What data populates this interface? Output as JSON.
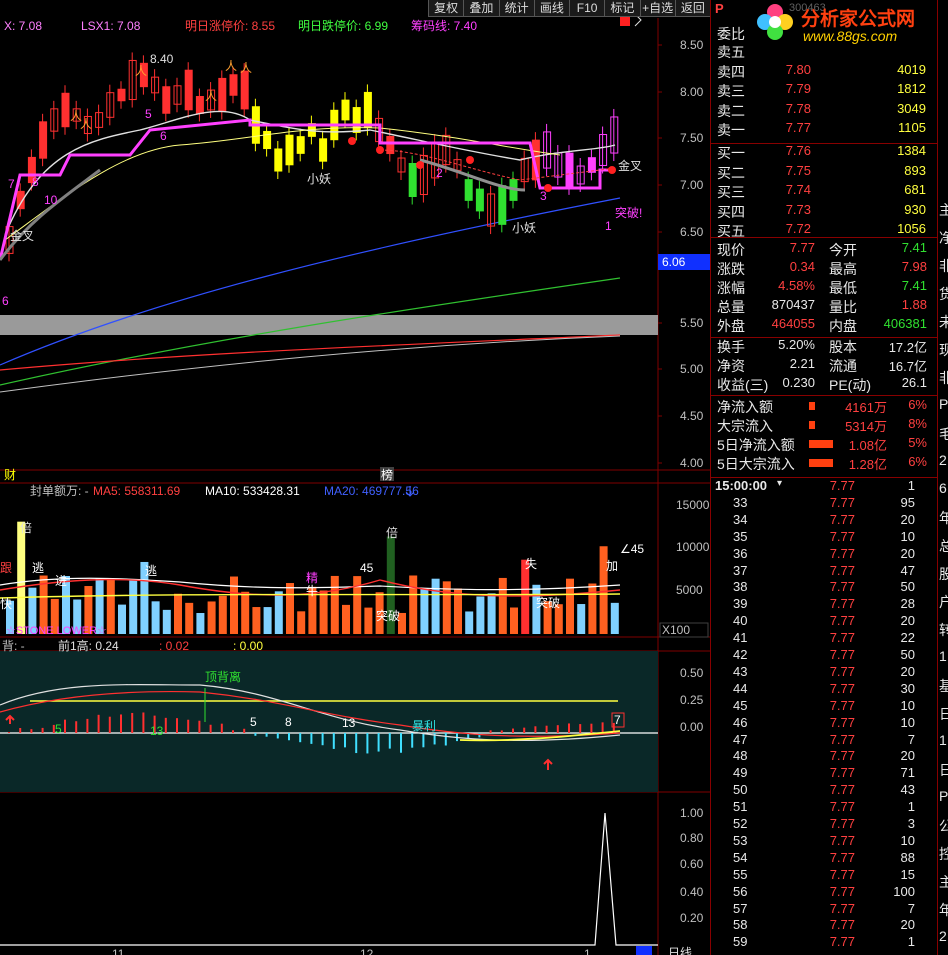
{
  "toolbar": [
    "复权",
    "叠加",
    "统计",
    "画线",
    "F10",
    "标记",
    "+自选",
    "返回"
  ],
  "main_header": [
    {
      "t": "X: 7.08",
      "c": "#ff80ff"
    },
    {
      "t": "LSX1: 7.08",
      "c": "#ff80ff"
    },
    {
      "t": "明日涨停价: 8.55",
      "c": "#ff4040"
    },
    {
      "t": "明日跌停价: 6.99",
      "c": "#40ff40"
    },
    {
      "t": "筹码线: 7.40",
      "c": "#ff40ff"
    }
  ],
  "price_axis": [
    "8.50",
    "8.00",
    "7.50",
    "7.00",
    "6.50",
    "6.06",
    "5.50",
    "5.00",
    "4.50",
    "4.00"
  ],
  "price_labels": {
    "hi": "8.40",
    "jincha1": "金叉",
    "jincha2": "金叉",
    "xiaoyao1": "小妖",
    "xiaoyao2": "小妖",
    "tupo": "突破!",
    "six": "6",
    "cai": "财",
    "bang": "榜",
    "n1": "1",
    "n2": "2",
    "n3": "3",
    "n5": "5",
    "n6": "6",
    "n7": "7",
    "n8": "8",
    "n10": "10",
    "num1b": "1"
  },
  "vol_header": [
    {
      "t": "封单额万: -",
      "c": "#c0c0c0"
    },
    {
      "t": "MA5: 558311.69",
      "c": "#ff4040"
    },
    {
      "t": "MA10: 533428.31",
      "c": "#ffffff"
    },
    {
      "t": "MA20: 469777.56",
      "c": "#4060ff"
    }
  ],
  "vol_axis": [
    "15000",
    "10000",
    "5000",
    "X100"
  ],
  "vol_labels": {
    "bei1": "倍",
    "bei2": "倍",
    "tao1": "逃",
    "tao2": "逃",
    "jin": "进",
    "gen": "跟",
    "jing": "精",
    "niu": "牛",
    "n45a": "45",
    "n45b": "∠45",
    "jia": "加",
    "tupo1": "突破",
    "tupo2": "突破",
    "star": "☆STONE LOWER☆",
    "kuai": "快"
  },
  "macd_header": [
    {
      "t": "背: -",
      "c": "#c0c0c0"
    },
    {
      "t": "前1高: 0.24",
      "c": "#e0e0e0"
    },
    {
      "t": ": 0.02",
      "c": "#ff4040"
    },
    {
      "t": ": 0.00",
      "c": "#ffff40"
    }
  ],
  "macd_axis": [
    "0.50",
    "0.25",
    "0.00"
  ],
  "macd_labels": {
    "dingbeili": "顶背离",
    "n5a": "5",
    "n13a": "13",
    "n5b": "5",
    "n8": "8",
    "n13b": "13",
    "baoli": "暴利",
    "n7": "7"
  },
  "bot_axis": [
    "1.00",
    "0.80",
    "0.60",
    "0.40",
    "0.20"
  ],
  "bottom_labels": {
    "d11": "11",
    "d12": "12",
    "d1": "1",
    "ribs": "日线"
  },
  "stock_header": {
    "title": "P",
    "code": "300463",
    "pane": "委比",
    "logo_main": "分析家公式网",
    "logo_url": "www.88gs.com"
  },
  "orderbook": [
    {
      "label": "卖五",
      "price": "",
      "vol": "",
      "lc": "wht"
    },
    {
      "label": "卖四",
      "price": "7.80",
      "vol": "4019"
    },
    {
      "label": "卖三",
      "price": "7.79",
      "vol": "1812"
    },
    {
      "label": "卖二",
      "price": "7.78",
      "vol": "3049"
    },
    {
      "label": "卖一",
      "price": "7.77",
      "vol": "1105"
    },
    {
      "label": "买一",
      "price": "7.76",
      "vol": "1384"
    },
    {
      "label": "买二",
      "price": "7.75",
      "vol": "893"
    },
    {
      "label": "买三",
      "price": "7.74",
      "vol": "681"
    },
    {
      "label": "买四",
      "price": "7.73",
      "vol": "930"
    },
    {
      "label": "买五",
      "price": "7.72",
      "vol": "1056"
    }
  ],
  "quote": [
    {
      "l1": "现价",
      "v1": "7.77",
      "c1": "red",
      "l2": "今开",
      "v2": "7.41",
      "c2": "grn"
    },
    {
      "l1": "涨跌",
      "v1": "0.34",
      "c1": "red",
      "l2": "最高",
      "v2": "7.98",
      "c2": "red"
    },
    {
      "l1": "涨幅",
      "v1": "4.58%",
      "c1": "red",
      "l2": "最低",
      "v2": "7.41",
      "c2": "grn"
    },
    {
      "l1": "总量",
      "v1": "870437",
      "c1": "wht",
      "l2": "量比",
      "v2": "1.88",
      "c2": "red"
    },
    {
      "l1": "外盘",
      "v1": "464055",
      "c1": "red",
      "l2": "内盘",
      "v2": "406381",
      "c2": "grn"
    }
  ],
  "fund": [
    {
      "l1": "换手",
      "v1": "5.20%",
      "l2": "股本",
      "v2": "17.2亿"
    },
    {
      "l1": "净资",
      "v1": "2.21",
      "l2": "流通",
      "v2": "16.7亿"
    },
    {
      "l1": "收益(三)",
      "v1": "0.230",
      "l2": "PE(动)",
      "v2": "26.1"
    }
  ],
  "flow": [
    {
      "l": "净流入额",
      "v": "4161万",
      "p": "6%"
    },
    {
      "l": "大宗流入",
      "v": "5314万",
      "p": "8%"
    },
    {
      "l": "5日净流入额",
      "v": "1.08亿",
      "p": "5%"
    },
    {
      "l": "5日大宗流入",
      "v": "1.28亿",
      "p": "6%"
    }
  ],
  "ticks": [
    {
      "t": "15:00:00",
      "p": "7.77",
      "v": "1"
    },
    {
      "t": "33",
      "p": "7.77",
      "v": "95"
    },
    {
      "t": "34",
      "p": "7.77",
      "v": "20"
    },
    {
      "t": "35",
      "p": "7.77",
      "v": "10"
    },
    {
      "t": "36",
      "p": "7.77",
      "v": "20"
    },
    {
      "t": "37",
      "p": "7.77",
      "v": "47"
    },
    {
      "t": "38",
      "p": "7.77",
      "v": "50"
    },
    {
      "t": "39",
      "p": "7.77",
      "v": "28"
    },
    {
      "t": "40",
      "p": "7.77",
      "v": "20"
    },
    {
      "t": "41",
      "p": "7.77",
      "v": "22"
    },
    {
      "t": "42",
      "p": "7.77",
      "v": "50"
    },
    {
      "t": "43",
      "p": "7.77",
      "v": "20"
    },
    {
      "t": "44",
      "p": "7.77",
      "v": "30"
    },
    {
      "t": "45",
      "p": "7.77",
      "v": "10"
    },
    {
      "t": "46",
      "p": "7.77",
      "v": "10"
    },
    {
      "t": "47",
      "p": "7.77",
      "v": "7"
    },
    {
      "t": "48",
      "p": "7.77",
      "v": "20"
    },
    {
      "t": "49",
      "p": "7.77",
      "v": "71"
    },
    {
      "t": "50",
      "p": "7.77",
      "v": "43"
    },
    {
      "t": "51",
      "p": "7.77",
      "v": "1"
    },
    {
      "t": "52",
      "p": "7.77",
      "v": "3"
    },
    {
      "t": "53",
      "p": "7.77",
      "v": "10"
    },
    {
      "t": "54",
      "p": "7.77",
      "v": "88"
    },
    {
      "t": "55",
      "p": "7.77",
      "v": "15"
    },
    {
      "t": "56",
      "p": "7.77",
      "v": "100"
    },
    {
      "t": "57",
      "p": "7.77",
      "v": "7"
    },
    {
      "t": "58",
      "p": "7.77",
      "v": "20"
    },
    {
      "t": "59",
      "p": "7.77",
      "v": "1"
    }
  ],
  "edge_chars": [
    "主",
    "净",
    "非",
    "货",
    "未",
    "现",
    "非",
    "P",
    "毛",
    "2",
    "6",
    "年",
    "总",
    "股",
    "户",
    "转",
    "1",
    "基",
    "日",
    "1",
    "日",
    "P",
    "公",
    "控",
    "主",
    "年",
    "2"
  ],
  "colors": {
    "up": "#ff3030",
    "down": "#00e0e0",
    "ma5": "#ffffff",
    "ma10": "#ffff00",
    "ma20": "#ff40ff",
    "ma60": "#4060ff",
    "axis": "#800000"
  }
}
